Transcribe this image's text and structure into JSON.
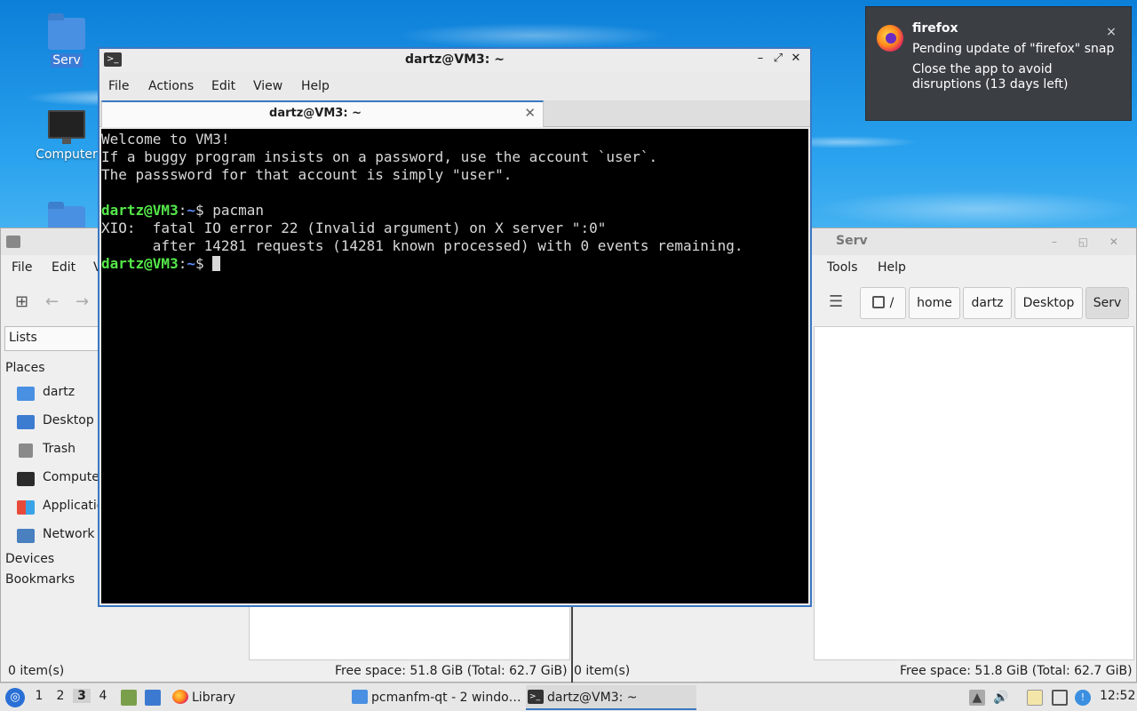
{
  "desktop": {
    "icons": [
      {
        "label": "Serv",
        "icon": "folder-icon"
      },
      {
        "label": "Computer",
        "icon": "computer-icon"
      },
      {
        "label": "",
        "icon": "home-folder-icon"
      }
    ]
  },
  "notification": {
    "app": "firefox",
    "line1": "Pending update of \"firefox\" snap",
    "line2": "Close the app to avoid disruptions (13 days left)",
    "close_glyph": "×",
    "icon": "firefox-icon"
  },
  "file_manager": {
    "title": "Serv",
    "menu": [
      "File",
      "Edit",
      "V",
      "Tools",
      "Help"
    ],
    "sidebar_mode": "Lists",
    "places_heading": "Places",
    "places": [
      "dartz",
      "Desktop",
      "Trash",
      "Compute",
      "Applicatio",
      "Network"
    ],
    "devices_heading": "Devices",
    "bookmarks_heading": "Bookmarks",
    "path_root": "/",
    "path": [
      "home",
      "dartz",
      "Desktop",
      "Serv"
    ],
    "status_left_1": "0 item(s)",
    "status_right_1": "Free space: 51.8 GiB (Total: 62.7 GiB)",
    "status_left_2": "0 item(s)",
    "status_right_2": "Free space: 51.8 GiB (Total: 62.7 GiB)"
  },
  "terminal": {
    "title": "dartz@VM3: ~",
    "menu": [
      "File",
      "Actions",
      "Edit",
      "View",
      "Help"
    ],
    "tab_label": "dartz@VM3: ~",
    "lines": [
      "Welcome to VM3!",
      "If a buggy program insists on a password, use the account `user`.",
      "The passsword for that account is simply \"user\".",
      "",
      "XIO:  fatal IO error 22 (Invalid argument) on X server \":0\"",
      "      after 14281 requests (14281 known processed) with 0 events remaining."
    ],
    "prompt_user": "dartz@VM3",
    "prompt_sep": ":",
    "prompt_path": "~",
    "prompt_dollar": "$ ",
    "command": "pacman"
  },
  "taskbar": {
    "workspaces": [
      "1",
      "2",
      "3",
      "4"
    ],
    "active_workspace": "3",
    "tasks": [
      {
        "label": "Library",
        "icon": "firefox-icon"
      },
      {
        "label": "pcmanfm-qt - 2 windo…",
        "icon": "folder-icon"
      },
      {
        "label": "dartz@VM3: ~",
        "icon": "terminal-icon"
      }
    ],
    "clock": "12:52"
  },
  "colors": {
    "accent": "#3a77c2",
    "prompt_user": "#55e84a",
    "prompt_path": "#5b8cf5",
    "terminal_bg": "#000000"
  }
}
